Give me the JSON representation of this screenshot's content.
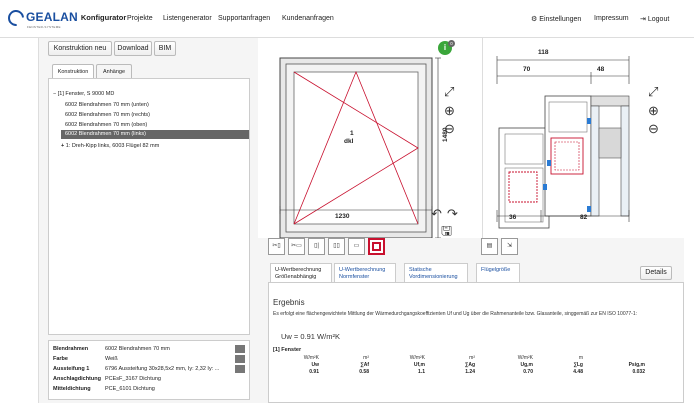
{
  "brand": {
    "name": "GEALAN",
    "sub": "FENSTER-SYSTEME",
    "app": "Konfigurator"
  },
  "nav": {
    "items": [
      "Projekte",
      "Listengenerator",
      "Supportanfragen",
      "Kundenanfragen"
    ],
    "settings": "Einstellungen",
    "imprint": "Impressum",
    "logout": "Logout"
  },
  "toolbar": {
    "new": "Konstruktion neu",
    "download": "Download",
    "bim": "BIM"
  },
  "left_tabs": {
    "construction": "Konstruktion",
    "attachments": "Anhänge"
  },
  "tree": {
    "root": "[1] Fenster, S 9000 MD",
    "items": [
      "6002 Blendrahmen 70 mm (unten)",
      "6002 Blendrahmen 70 mm (rechts)",
      "6002 Blendrahmen 70 mm (oben)",
      "6002 Blendrahmen 70 mm (links)"
    ],
    "child": "1: Dreh-Kipp links, 6003 Flügel 82 mm"
  },
  "props": [
    {
      "key": "Blendrahmen",
      "value": "6002 Blendrahmen 70 mm"
    },
    {
      "key": "Farbe",
      "value": "Weiß"
    },
    {
      "key": "Aussteifung 1",
      "value": "6796 Aussteifung 30x28,5x2 mm, Iy: 2,32 Iy: ..."
    },
    {
      "key": "Anschlagdichtung",
      "value": "PCEsF_3167 Dichtung"
    },
    {
      "key": "Mitteldichtung",
      "value": "PCE_6101 Dichtung"
    }
  ],
  "window": {
    "width": "1230",
    "height": "1480",
    "sash_no": "1",
    "sash_type": "dkl",
    "badge": "0"
  },
  "section": {
    "top_total": "118",
    "top_left": "70",
    "top_right": "48",
    "bottom_left": "36",
    "bottom_right": "82"
  },
  "calc_tabs": [
    {
      "l1": "U-Wertberechnung",
      "l2": "Größenabhängig"
    },
    {
      "l1": "U-Wertberechnung",
      "l2": "Normfenster"
    },
    {
      "l1": "Statische",
      "l2": "Vordimensionierung"
    },
    {
      "l1": "Flügelgröße",
      "l2": ""
    }
  ],
  "details": "Details",
  "result": {
    "title": "Ergebnis",
    "desc": "Es erfolgt eine flächengewichtete Mittlung der Wärmedurchgangskoeffizienten Uf und Ug über die Rahmenanteile bzw. Glasanteile, singgemäß zur EN ISO 10077-1:",
    "uw": "Uw = 0.91 W/m²K",
    "section": "[1] Fenster",
    "units": [
      "W/m²K",
      "m²",
      "W/m²K",
      "m²",
      "W/m²K",
      "m",
      ""
    ],
    "labels": [
      "Uw",
      "∑Af",
      "Uf,m",
      "∑Ag",
      "Ug,m",
      "∑Lg",
      "Psig,m"
    ],
    "values": [
      "0.91",
      "0.58",
      "1.1",
      "1.24",
      "0.70",
      "4.48",
      "0.032"
    ]
  },
  "colors": {
    "brand": "#1a4fa0",
    "badge": "#3aa63a",
    "selected": "#666666",
    "red": "#c8102e"
  }
}
